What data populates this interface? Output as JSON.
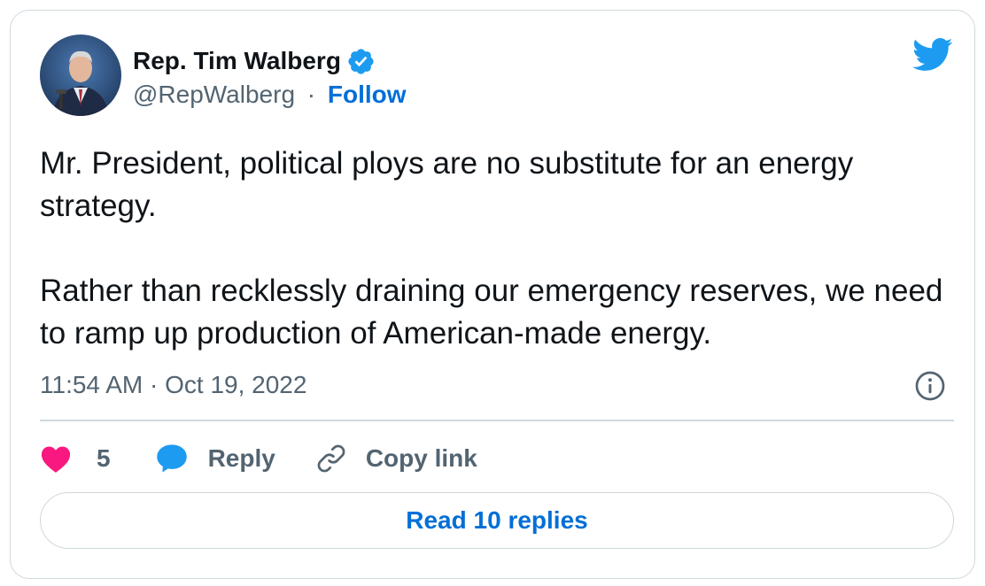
{
  "author": {
    "display_name": "Rep. Tim Walberg",
    "handle": "@RepWalberg",
    "separator": "·",
    "follow_label": "Follow",
    "verified": true
  },
  "tweet": {
    "paragraph_1": "Mr. President, political ploys are no substitute for an energy strategy.",
    "paragraph_2": "Rather than recklessly draining our emergency reserves, we need to ramp up production of American-made energy.",
    "timestamp": "11:54 AM · Oct 19, 2022"
  },
  "actions": {
    "like_count": "5",
    "reply_label": "Reply",
    "copy_link_label": "Copy link"
  },
  "read_replies_label": "Read 10 replies",
  "icons": {
    "platform": "twitter-bird-icon",
    "verified": "verified-badge-icon",
    "info": "info-icon",
    "like": "heart-icon",
    "reply": "speech-bubble-icon",
    "copy": "link-icon"
  },
  "colors": {
    "brand_blue": "#1d9bf0",
    "link_blue": "#006fd6",
    "like_pink": "#f91880",
    "text": "#0f1419",
    "muted": "#536471",
    "border": "#cfd9de"
  }
}
